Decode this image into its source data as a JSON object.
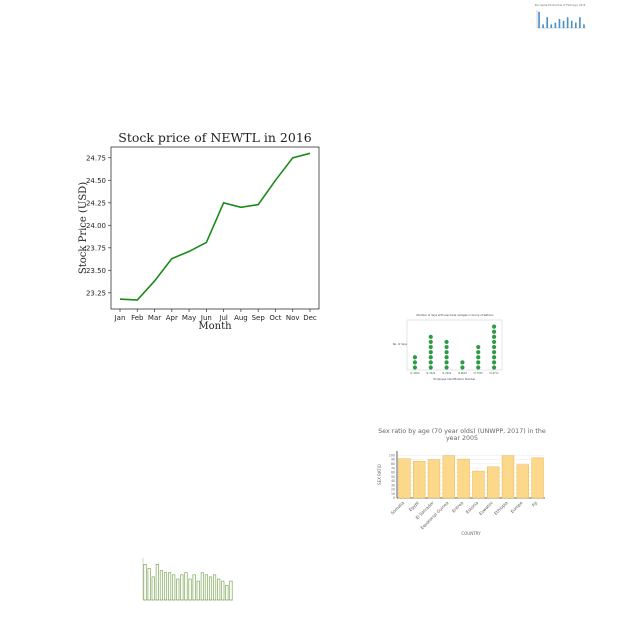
{
  "chart_data": [
    {
      "id": "main",
      "type": "line",
      "title": "Stock price of NEWTL in 2016",
      "xlabel": "Month",
      "ylabel": "Stock Price (USD)",
      "categories": [
        "Jan",
        "Feb",
        "Mar",
        "Apr",
        "May",
        "Jun",
        "Jul",
        "Aug",
        "Sep",
        "Oct",
        "Nov",
        "Dec"
      ],
      "values": [
        23.18,
        23.17,
        23.38,
        23.63,
        23.71,
        23.81,
        24.25,
        24.2,
        24.23,
        24.5,
        24.75,
        24.8
      ],
      "ylim": [
        23.07,
        24.87
      ],
      "yticks": [
        "23.25",
        "23.50",
        "23.75",
        "24.00",
        "24.25",
        "24.50",
        "24.75"
      ],
      "grid": false,
      "color": "#1a8a1a"
    },
    {
      "id": "top-right",
      "type": "bar",
      "title": "Per capita Production of Fish (kg), 2014",
      "categories": [
        "",
        "",
        "",
        "",
        "",
        "",
        "",
        "",
        "",
        "",
        "",
        ""
      ],
      "values": [
        9,
        2,
        6,
        2,
        3,
        5,
        4,
        6,
        4,
        3,
        6,
        2
      ],
      "ylim": [
        0,
        10
      ],
      "color": "#4a8fc9"
    },
    {
      "id": "dots",
      "type": "scatter",
      "title": "Number of days with electrical outages in Group of Nations",
      "xlabel": "Employee Identification Number",
      "ylabel": "No. of days",
      "categories": [
        "I1-4000",
        "I2-3222",
        "I3-7902",
        "I4-8067",
        "I5-7935",
        "I6-9772"
      ],
      "values": [
        3,
        7,
        6,
        2,
        5,
        9
      ],
      "ylim": [
        0,
        10
      ],
      "color": "#2e9a45"
    },
    {
      "id": "sex-ratio",
      "type": "bar",
      "title": "Sex ratio by age (70 year olds) (UNWPP, 2017) in the year 2005",
      "xlabel": "COUNTRY",
      "ylabel": "SEX RATIO",
      "categories": [
        "Somalia",
        "Egypt",
        "El Salvador",
        "Equatorial Guinea",
        "Eritrea",
        "Estonia",
        "Eswatini",
        "Ethiopia",
        "Europe",
        "Fiji"
      ],
      "values": [
        92,
        86,
        90,
        99,
        91,
        63,
        73,
        99,
        78,
        94
      ],
      "ylim": [
        0,
        110
      ],
      "yticks": [
        "0",
        "10",
        "20",
        "30",
        "40",
        "50",
        "60",
        "70",
        "80",
        "90",
        "100"
      ],
      "color": "#fbd88a"
    },
    {
      "id": "bottom-left",
      "type": "bar",
      "title": "",
      "categories": [
        "",
        "",
        "",
        "",
        "",
        "",
        "",
        "",
        "",
        "",
        "",
        "",
        "",
        "",
        "",
        "",
        "",
        "",
        "",
        "",
        "",
        ""
      ],
      "values": [
        8.5,
        7.5,
        5.5,
        8.5,
        7,
        6.5,
        6.5,
        6,
        5,
        6,
        6.5,
        5,
        6,
        4.5,
        6.5,
        6,
        5.5,
        6,
        5,
        4.5,
        3.5,
        4.5
      ],
      "ylim": [
        0,
        10
      ],
      "color": "#6b9e3c"
    }
  ]
}
